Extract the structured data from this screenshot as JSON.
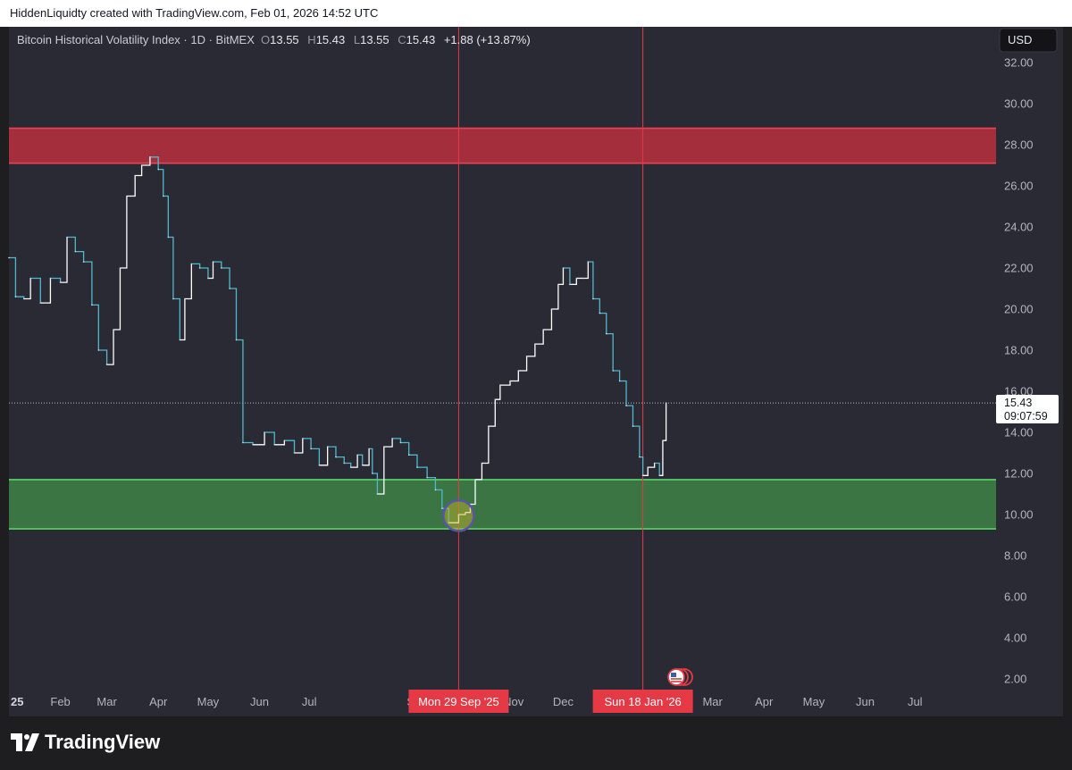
{
  "header": {
    "attribution": "HiddenLiquidty created with TradingView.com, Feb 01, 2026 14:52 UTC"
  },
  "legend": {
    "symbol": "Bitcoin Historical Volatility Index · 1D · BitMEX",
    "o_label": "O",
    "o_value": "13.55",
    "h_label": "H",
    "h_value": "15.43",
    "l_label": "L",
    "l_value": "13.55",
    "c_label": "C",
    "c_value": "15.43",
    "change": "+1.88 (+13.87%)"
  },
  "currency": "USD",
  "price_tag": {
    "value": "15.43",
    "countdown": "09:07:59"
  },
  "footer": {
    "brand": "TradingView"
  },
  "colors": {
    "background": "#2a2a34",
    "line_down": "#4fb8cf",
    "line_up": "#ffffff",
    "resistance_zone": "#b02f3e",
    "support_zone": "#3d7c44",
    "marker_line": "#e53946",
    "circle": "#5b54a8"
  },
  "chart_data": {
    "type": "line",
    "title": "Bitcoin Historical Volatility Index · 1D · BitMEX",
    "ylim": [
      0.6,
      33.0
    ],
    "y_ticks": [
      "32.00",
      "30.00",
      "28.00",
      "26.00",
      "24.00",
      "22.00",
      "20.00",
      "18.00",
      "16.00",
      "14.00",
      "12.00",
      "10.00",
      "8.00",
      "6.00",
      "4.00",
      "2.00"
    ],
    "x_range": [
      "2025-01-01",
      "2026-07-31"
    ],
    "x_ticks": [
      {
        "label": "25",
        "date": "2025-01-01"
      },
      {
        "label": "Feb",
        "date": "2025-02-01"
      },
      {
        "label": "Mar",
        "date": "2025-03-01"
      },
      {
        "label": "Apr",
        "date": "2025-04-01"
      },
      {
        "label": "May",
        "date": "2025-05-01"
      },
      {
        "label": "Jun",
        "date": "2025-06-01"
      },
      {
        "label": "Jul",
        "date": "2025-07-01"
      },
      {
        "label": "Se",
        "date": "2025-09-01"
      },
      {
        "label": "Nov",
        "date": "2025-11-01"
      },
      {
        "label": "Dec",
        "date": "2025-12-01"
      },
      {
        "label": "Mar",
        "date": "2026-03-01"
      },
      {
        "label": "Apr",
        "date": "2026-04-01"
      },
      {
        "label": "May",
        "date": "2026-05-01"
      },
      {
        "label": "Jun",
        "date": "2026-06-01"
      },
      {
        "label": "Jul",
        "date": "2026-07-01"
      }
    ],
    "series": [
      {
        "points": [
          [
            "2025-01-01",
            22.5
          ],
          [
            "2025-01-05",
            20.6
          ],
          [
            "2025-01-10",
            20.5
          ],
          [
            "2025-01-14",
            21.5
          ],
          [
            "2025-01-20",
            20.3
          ],
          [
            "2025-01-26",
            21.5
          ],
          [
            "2025-02-01",
            21.3
          ],
          [
            "2025-02-05",
            23.5
          ],
          [
            "2025-02-10",
            22.8
          ],
          [
            "2025-02-15",
            22.3
          ],
          [
            "2025-02-20",
            20.2
          ],
          [
            "2025-02-24",
            18.0
          ],
          [
            "2025-03-01",
            17.3
          ],
          [
            "2025-03-05",
            19.0
          ],
          [
            "2025-03-09",
            22.0
          ],
          [
            "2025-03-13",
            25.5
          ],
          [
            "2025-03-18",
            26.5
          ],
          [
            "2025-03-22",
            27.0
          ],
          [
            "2025-03-27",
            27.4
          ],
          [
            "2025-04-01",
            26.8
          ],
          [
            "2025-04-04",
            25.5
          ],
          [
            "2025-04-07",
            23.5
          ],
          [
            "2025-04-10",
            20.5
          ],
          [
            "2025-04-14",
            18.5
          ],
          [
            "2025-04-17",
            20.5
          ],
          [
            "2025-04-21",
            22.2
          ],
          [
            "2025-04-26",
            22.0
          ],
          [
            "2025-05-01",
            21.5
          ],
          [
            "2025-05-04",
            22.3
          ],
          [
            "2025-05-09",
            22.0
          ],
          [
            "2025-05-14",
            21.0
          ],
          [
            "2025-05-18",
            18.5
          ],
          [
            "2025-05-22",
            13.5
          ],
          [
            "2025-05-28",
            13.4
          ],
          [
            "2025-06-04",
            14.0
          ],
          [
            "2025-06-10",
            13.4
          ],
          [
            "2025-06-16",
            13.6
          ],
          [
            "2025-06-22",
            13.0
          ],
          [
            "2025-06-27",
            13.7
          ],
          [
            "2025-07-02",
            13.2
          ],
          [
            "2025-07-07",
            12.4
          ],
          [
            "2025-07-12",
            13.3
          ],
          [
            "2025-07-17",
            12.8
          ],
          [
            "2025-07-22",
            12.5
          ],
          [
            "2025-07-26",
            12.3
          ],
          [
            "2025-07-30",
            12.9
          ],
          [
            "2025-08-02",
            12.4
          ],
          [
            "2025-08-06",
            13.2
          ],
          [
            "2025-08-08",
            12.0
          ],
          [
            "2025-08-11",
            11.0
          ],
          [
            "2025-08-15",
            13.3
          ],
          [
            "2025-08-20",
            13.7
          ],
          [
            "2025-08-25",
            13.5
          ],
          [
            "2025-08-30",
            12.9
          ],
          [
            "2025-09-04",
            12.3
          ],
          [
            "2025-09-10",
            11.8
          ],
          [
            "2025-09-15",
            11.2
          ],
          [
            "2025-09-19",
            10.3
          ],
          [
            "2025-09-23",
            9.6
          ],
          [
            "2025-09-29",
            10.0
          ],
          [
            "2025-10-03",
            10.1
          ],
          [
            "2025-10-06",
            10.5
          ],
          [
            "2025-10-09",
            11.7
          ],
          [
            "2025-10-13",
            12.5
          ],
          [
            "2025-10-17",
            14.3
          ],
          [
            "2025-10-21",
            15.6
          ],
          [
            "2025-10-24",
            16.3
          ],
          [
            "2025-10-30",
            16.5
          ],
          [
            "2025-11-04",
            17.0
          ],
          [
            "2025-11-09",
            17.7
          ],
          [
            "2025-11-14",
            18.3
          ],
          [
            "2025-11-19",
            19.0
          ],
          [
            "2025-11-24",
            20.0
          ],
          [
            "2025-11-28",
            21.2
          ],
          [
            "2025-12-01",
            22.0
          ],
          [
            "2025-12-05",
            21.2
          ],
          [
            "2025-12-09",
            21.5
          ],
          [
            "2025-12-13",
            21.5
          ],
          [
            "2025-12-16",
            22.3
          ],
          [
            "2025-12-19",
            20.5
          ],
          [
            "2025-12-23",
            19.8
          ],
          [
            "2025-12-27",
            18.8
          ],
          [
            "2025-12-31",
            17.0
          ],
          [
            "2026-01-04",
            16.5
          ],
          [
            "2026-01-08",
            15.3
          ],
          [
            "2026-01-12",
            14.3
          ],
          [
            "2026-01-16",
            12.8
          ],
          [
            "2026-01-18",
            11.9
          ],
          [
            "2026-01-21",
            12.3
          ],
          [
            "2026-01-25",
            12.5
          ],
          [
            "2026-01-28",
            11.9
          ],
          [
            "2026-01-30",
            13.6
          ],
          [
            "2026-02-01",
            15.43
          ]
        ]
      }
    ],
    "zones": [
      {
        "color": "red",
        "y_from": 27.1,
        "y_to": 28.8
      },
      {
        "color": "green",
        "y_from": 9.3,
        "y_to": 11.7
      }
    ],
    "markers": [
      {
        "date": "2025-09-29",
        "label": "Mon 29 Sep '25"
      },
      {
        "date": "2026-01-18",
        "label": "Sun 18 Jan '26"
      }
    ],
    "circle_highlight": {
      "date": "2025-09-29",
      "y": 9.9
    },
    "last_value": 15.43
  }
}
